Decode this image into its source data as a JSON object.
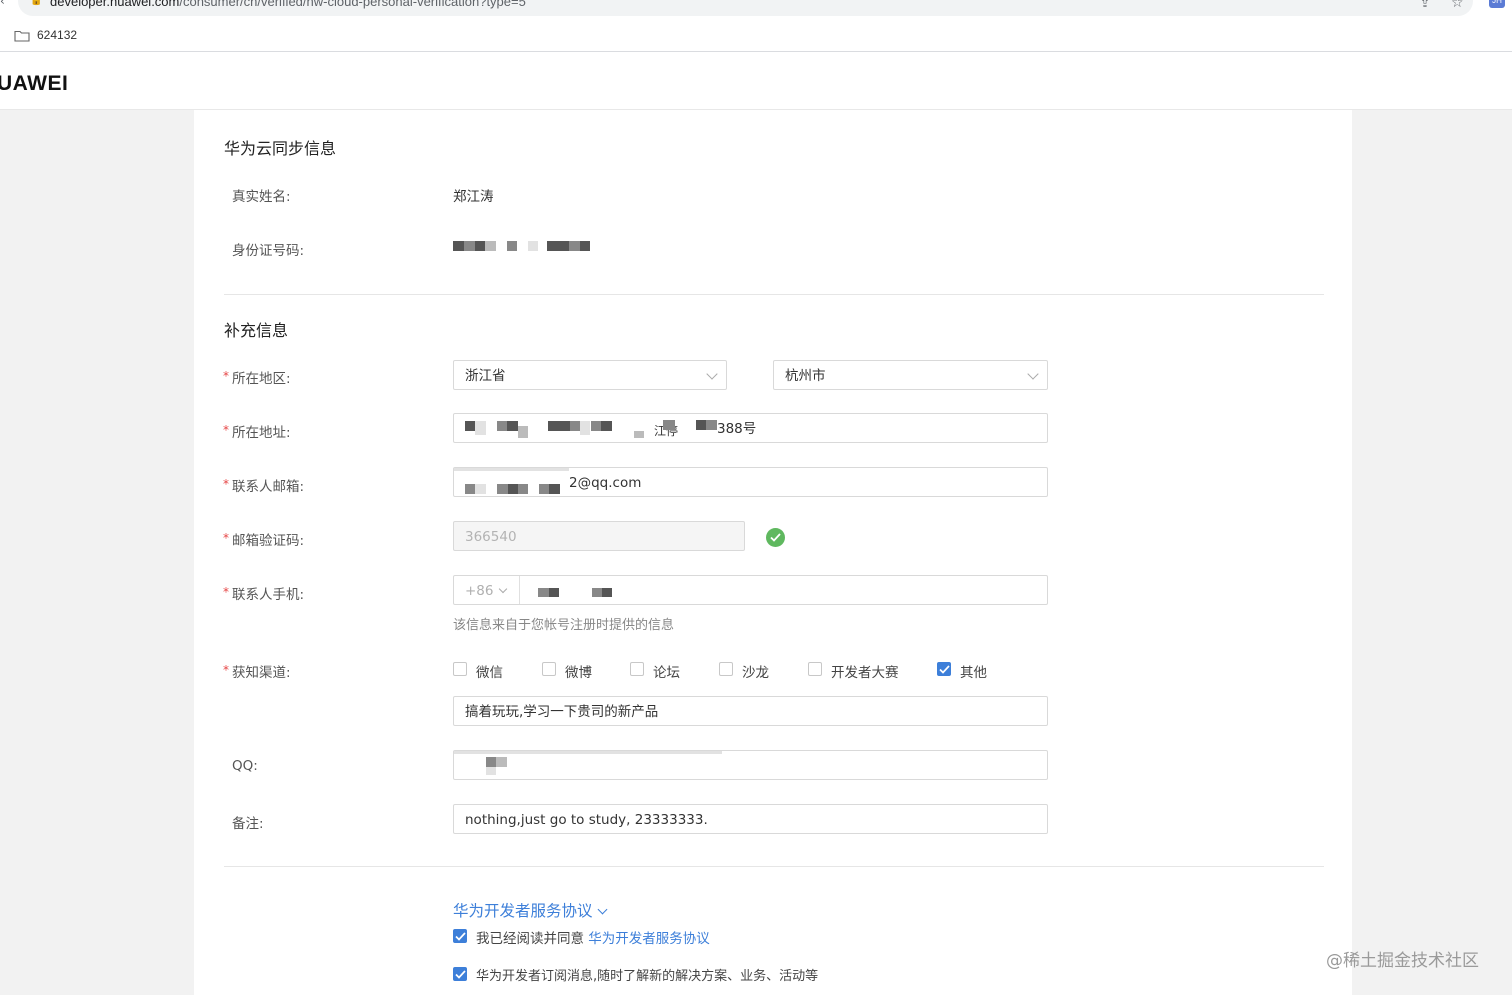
{
  "browser": {
    "url_host": "developer.huawei.com",
    "url_path": "/consumer/cn/verified/hw-cloud-personal-verification?type=5",
    "bookmark": "624132",
    "ext_badge": "JH"
  },
  "header": {
    "logo": "UAWEI"
  },
  "sync_section": {
    "title": "华为云同步信息",
    "real_name_label": "真实姓名:",
    "real_name_value": "郑江涛",
    "id_label": "身份证号码:"
  },
  "extra_section": {
    "title": "补充信息",
    "region_label": "所在地区:",
    "province": "浙江省",
    "city": "杭州市",
    "address_label": "所在地址:",
    "address_partial_1": "江停",
    "address_partial_2": "388号",
    "email_label": "联系人邮箱:",
    "email_partial": "2@qq.com",
    "code_label": "邮箱验证码:",
    "code_value": "366540",
    "phone_label": "联系人手机:",
    "phone_prefix": "+86",
    "phone_hint": "该信息来自于您帐号注册时提供的信息",
    "channel_label": "获知渠道:",
    "channels": [
      {
        "label": "微信",
        "checked": false
      },
      {
        "label": "微博",
        "checked": false
      },
      {
        "label": "论坛",
        "checked": false
      },
      {
        "label": "沙龙",
        "checked": false
      },
      {
        "label": "开发者大赛",
        "checked": false
      },
      {
        "label": "其他",
        "checked": true
      }
    ],
    "channel_other_value": "搞着玩玩,学习一下贵司的新产品",
    "qq_label": "QQ:",
    "remark_label": "备注:",
    "remark_value": "nothing,just go to study, 23333333."
  },
  "agreement": {
    "title": "华为开发者服务协议",
    "agree_text": "我已经阅读并同意",
    "agree_link": "华为开发者服务协议",
    "agree_checked": true,
    "subscribe_text": "华为开发者订阅消息,随时了解新的解决方案、业务、活动等",
    "subscribe_checked": true
  },
  "watermark": "@稀土掘金技术社区",
  "colors": {
    "accent": "#3d7fd9",
    "required": "#e64545",
    "success": "#5fb85f"
  }
}
